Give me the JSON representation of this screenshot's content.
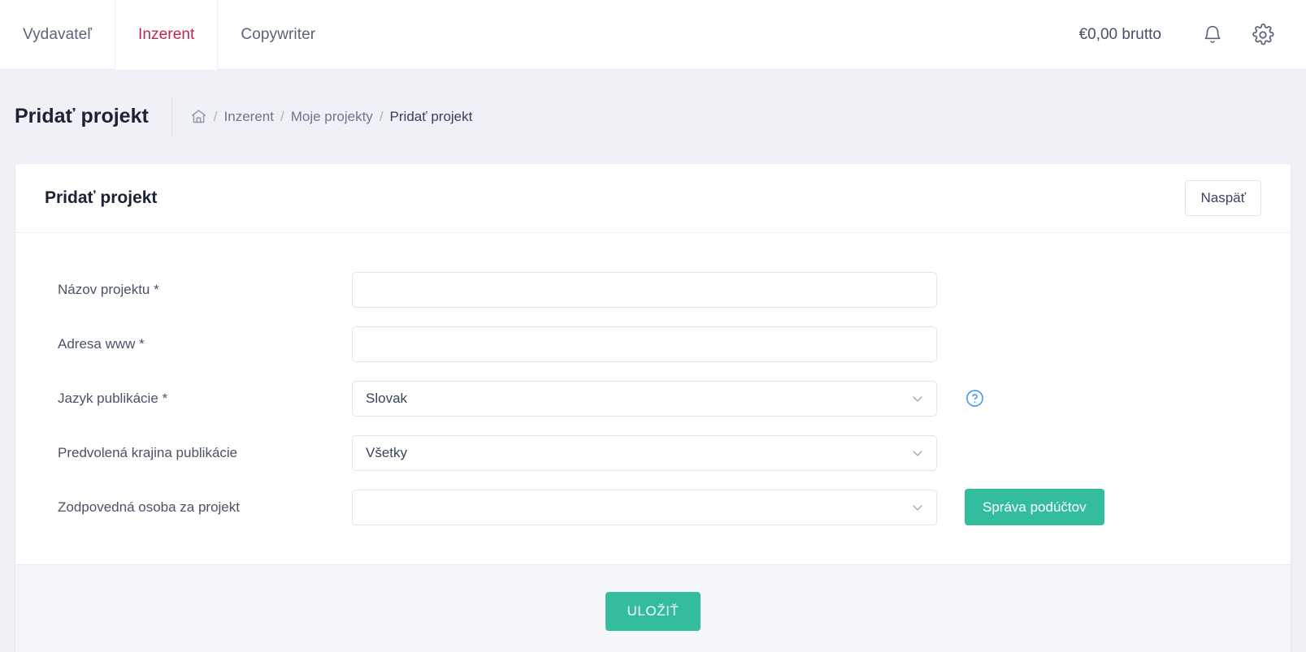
{
  "topnav": {
    "tabs": [
      {
        "label": "Vydavateľ",
        "active": false
      },
      {
        "label": "Inzerent",
        "active": true
      },
      {
        "label": "Copywriter",
        "active": false
      }
    ],
    "balance": "€0,00 brutto",
    "notifications_icon": "bell-icon",
    "settings_icon": "gear-icon"
  },
  "page": {
    "title": "Pridať projekt",
    "breadcrumb": {
      "home_icon": "home-icon",
      "items": [
        "Inzerent",
        "Moje projekty",
        "Pridať projekt"
      ],
      "separator": "/"
    }
  },
  "card": {
    "title": "Pridať projekt",
    "back_label": "Naspäť",
    "fields": [
      {
        "label": "Názov projektu *",
        "type": "text",
        "value": "",
        "placeholder": ""
      },
      {
        "label": "Adresa www *",
        "type": "text",
        "value": "",
        "placeholder": ""
      },
      {
        "label": "Jazyk publikácie *",
        "type": "select",
        "value": "Slovak",
        "addon": "help"
      },
      {
        "label": "Predvolená krajina publikácie",
        "type": "select",
        "value": "Všetky",
        "addon": ""
      },
      {
        "label": "Zodpovedná osoba za projekt",
        "type": "select",
        "value": "",
        "addon": "button"
      }
    ],
    "subaccounts_label": "Správa podúčtov",
    "save_label": "ULOŽIŤ"
  },
  "colors": {
    "accent_green": "#34bd9c",
    "active_tab_text": "#c0264c",
    "help_blue": "#3c97f3",
    "page_bg": "#eff1f6"
  }
}
